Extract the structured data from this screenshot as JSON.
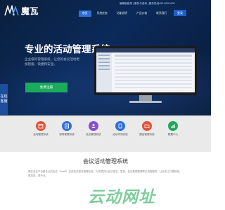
{
  "brand": {
    "logo_text": "魔瓦"
  },
  "header": {
    "top_links": "编辑版登录 | 服务与咨询 | 服务热线400-0000-000",
    "nav": [
      "首页",
      "系统优势",
      "功能说明",
      "产品价格",
      "联系我们"
    ],
    "active_nav": 0,
    "login_label": "登录"
  },
  "hero": {
    "title": "专业的活动管理系统",
    "subtitle": "企业级的管理系统，让您的会议活动更加智能、快捷和安全。",
    "cta_label": "免费注册"
  },
  "side_tab": {
    "line1": "在线",
    "line2": "客服"
  },
  "features": [
    {
      "label": "活动管理系统",
      "icon": "calendar-icon",
      "color": "#e0533a"
    },
    {
      "label": "现场管理系统",
      "icon": "clipboard-icon",
      "color": "#2f6fd6"
    },
    {
      "label": "会议管理系统",
      "icon": "people-icon",
      "color": "#8a4fd0"
    },
    {
      "label": "活动评测系统",
      "icon": "tablet-icon",
      "color": "#2f6fd6"
    },
    {
      "label": "展会管理系统",
      "icon": "folder-icon",
      "color": "#e0533a"
    },
    {
      "label": "数据中心",
      "icon": "chart-icon",
      "color": "#22a85b"
    }
  ],
  "section": {
    "title": "会议活动管理系统",
    "body": "魔瓦会议平台是专业的会议（SaaS）在线会议报名管理系统，为您提供从会议报名、签到、会后数据管理等全流程服务，让会务工作更轻松、更高效、更专业。"
  },
  "watermark": "云动网址"
}
